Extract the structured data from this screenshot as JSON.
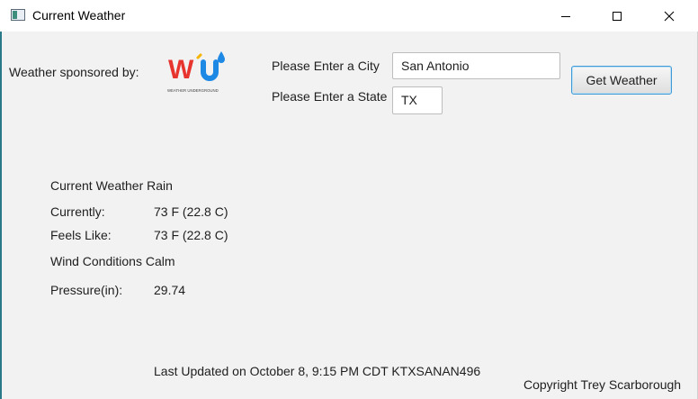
{
  "window": {
    "title": "Current Weather"
  },
  "header": {
    "sponsor_label": "Weather sponsored by:",
    "logo_caption": "WEATHER UNDERGROUND"
  },
  "form": {
    "city_label": "Please Enter a City",
    "city_value": "San Antonio",
    "state_label": "Please Enter a State",
    "state_value": "TX",
    "submit_label": "Get Weather"
  },
  "weather": {
    "condition_text": "Current Weather Rain",
    "currently_label": "Currently:",
    "currently_value": "73 F (22.8 C)",
    "feels_like_label": "Feels Like:",
    "feels_like_value": "73 F (22.8 C)",
    "wind_text": "Wind Conditions Calm",
    "pressure_label": "Pressure(in):",
    "pressure_value": "29.74"
  },
  "footer": {
    "last_updated": "Last Updated on October 8, 9:15 PM CDT KTXSANAN496",
    "copyright": "Copyright Trey Scarborough"
  }
}
